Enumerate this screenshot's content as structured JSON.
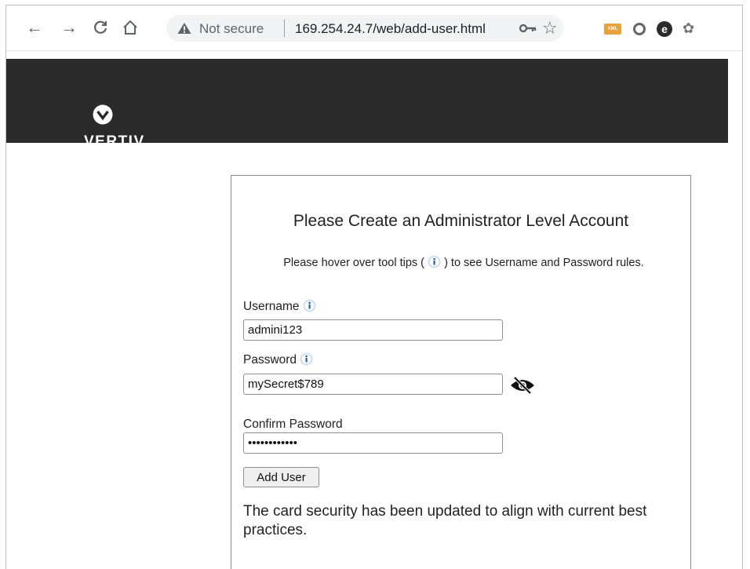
{
  "browser": {
    "security_label": "Not secure",
    "url": "169.254.24.7/web/add-user.html",
    "icons": [
      "back-icon",
      "forward-icon",
      "reload-icon",
      "home-icon",
      "warning-icon",
      "key-icon",
      "star-icon"
    ],
    "extensions": {
      "xml_label": "XML"
    }
  },
  "brand": {
    "name": "VERTIV",
    "trademark": ".",
    "background": "#2a2a2a"
  },
  "form": {
    "title": "Please Create an Administrator Level Account",
    "hint_before": "Please hover over tool tips (",
    "hint_after": ") to see Username and Password rules.",
    "username_label": "Username",
    "username_value": "admini123",
    "password_label": "Password",
    "password_value": "mySecret$789",
    "confirm_label": "Confirm Password",
    "confirm_value": "mySecret$789",
    "add_button": "Add User",
    "notice": "The card security has been updated to align with current best practices."
  }
}
